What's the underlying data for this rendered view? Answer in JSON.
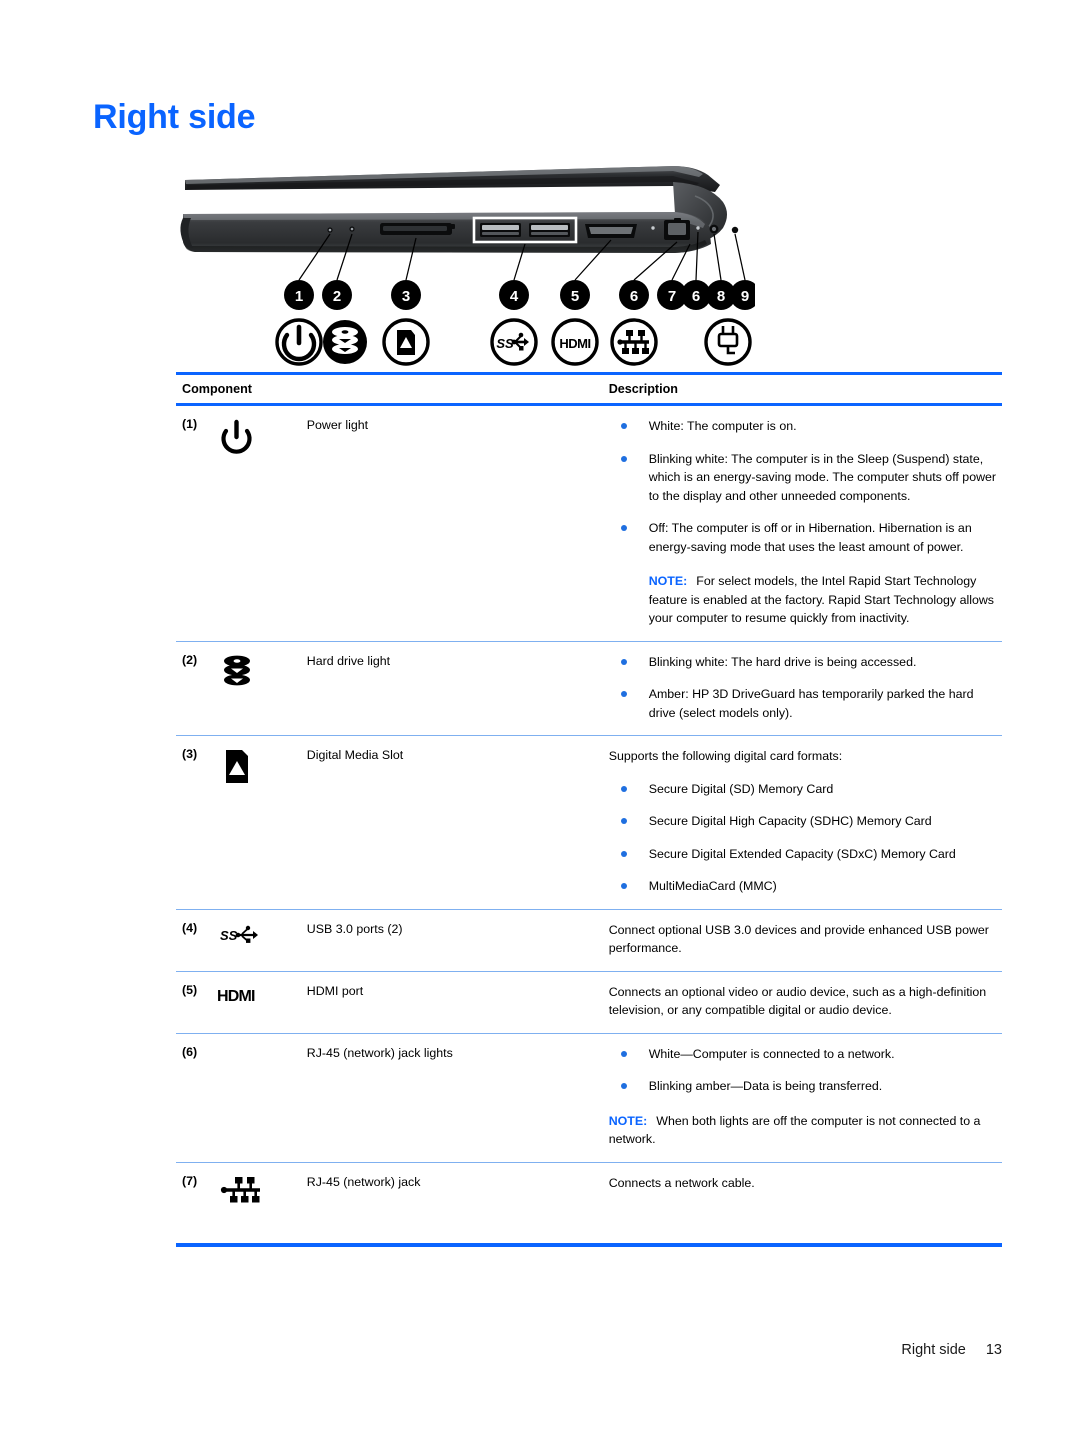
{
  "document": {
    "title": "Right side"
  },
  "figure": {
    "alt_name": "laptop-right-side-diagram",
    "callouts": [
      "1",
      "2",
      "3",
      "4",
      "5",
      "6",
      "7",
      "6",
      "8",
      "9"
    ],
    "icon_row": [
      "power-icon",
      "hard-drive-icon",
      "sd-card-icon",
      "usb-superspeed-icon",
      "hdmi-icon",
      "rj45-network-icon",
      "power-connector-icon"
    ]
  },
  "table": {
    "headers": {
      "component": "Component",
      "description": "Description"
    },
    "rows": [
      {
        "num": "(1)",
        "icon": "power-icon",
        "name": "Power light",
        "bullets": [
          "White: The computer is on.",
          "Blinking white: The computer is in the Sleep (Suspend) state, which is an energy-saving mode. The computer shuts off power to the display and other unneeded components.",
          "Off: The computer is off or in Hibernation. Hibernation is an energy-saving mode that uses the least amount of power."
        ],
        "note_label": "NOTE:",
        "note_text": "For select models, the Intel Rapid Start Technology feature is enabled at the factory. Rapid Start Technology allows your computer to resume quickly from inactivity.",
        "note_indented": true
      },
      {
        "num": "(2)",
        "icon": "hard-drive-icon",
        "name": "Hard drive light",
        "bullets": [
          "Blinking white: The hard drive is being accessed.",
          "Amber: HP 3D DriveGuard has temporarily parked the hard drive (select models only)."
        ]
      },
      {
        "num": "(3)",
        "icon": "sd-card-icon",
        "name": "Digital Media Slot",
        "intro": "Supports the following digital card formats:",
        "bullets": [
          "Secure Digital (SD) Memory Card",
          "Secure Digital High Capacity (SDHC) Memory Card",
          "Secure Digital Extended Capacity (SDxC) Memory Card",
          "MultiMediaCard (MMC)"
        ]
      },
      {
        "num": "(4)",
        "icon": "usb-superspeed-icon",
        "name": "USB 3.0 ports (2)",
        "description": "Connect optional USB 3.0 devices and provide enhanced USB power performance."
      },
      {
        "num": "(5)",
        "icon": "hdmi-icon",
        "name": "HDMI port",
        "description": "Connects an optional video or audio device, such as a high-definition television, or any compatible digital or audio device."
      },
      {
        "num": "(6)",
        "icon": "none",
        "name": "RJ-45 (network) jack lights",
        "bullets": [
          "White—Computer is connected to a network.",
          "Blinking amber—Data is being transferred."
        ],
        "note_label": "NOTE:",
        "note_text": "When both lights are off the computer is not connected to a network.",
        "note_indented": false
      },
      {
        "num": "(7)",
        "icon": "rj45-network-icon",
        "name": "RJ-45 (network) jack",
        "description": "Connects a network cable."
      }
    ]
  },
  "footer": {
    "section": "Right side",
    "page_number": "13"
  },
  "colors": {
    "accent_blue": "#0a64ff",
    "rule_blue": "#7fb0f0",
    "bullet_blue": "#1f6fe0"
  }
}
